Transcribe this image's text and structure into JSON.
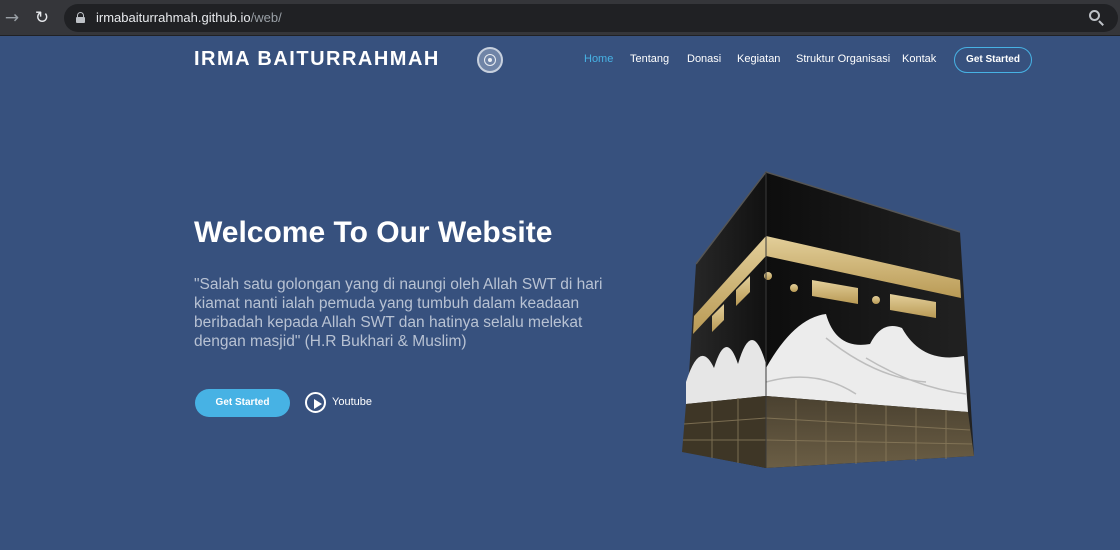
{
  "browser": {
    "url_host": "irmabaiturrahmah.github.io",
    "url_path": "/web/",
    "back_icon": "arrow-left-icon",
    "reload_icon": "reload-icon",
    "lock_icon": "lock-icon",
    "zoom_icon": "magnifier-icon"
  },
  "header": {
    "brand": "IRMA BAITURRAHMAH",
    "logo_icon": "mosque-emblem-icon",
    "nav": [
      {
        "label": "Home",
        "active": true
      },
      {
        "label": "Tentang",
        "active": false
      },
      {
        "label": "Donasi",
        "active": false
      },
      {
        "label": "Kegiatan",
        "active": false
      },
      {
        "label": "Struktur Organisasi",
        "active": false
      },
      {
        "label": "Kontak",
        "active": false
      }
    ],
    "cta_label": "Get Started"
  },
  "hero": {
    "title": "Welcome To Our Website",
    "quote": "\"Salah satu golongan yang di naungi oleh Allah SWT di hari kiamat nanti ialah pemuda yang tumbuh dalam keadaan beribadah kepada Allah SWT dan hatinya selalu melekat dengan masjid\" (H.R Bukhari & Muslim)",
    "cta_label": "Get Started",
    "video_label": "Youtube",
    "video_icon": "play-circle-icon",
    "illustration": "kaaba-illustration"
  },
  "colors": {
    "background": "#37517e",
    "accent": "#47b2e4",
    "text": "#ffffff",
    "muted_text": "#b8c2d3"
  }
}
